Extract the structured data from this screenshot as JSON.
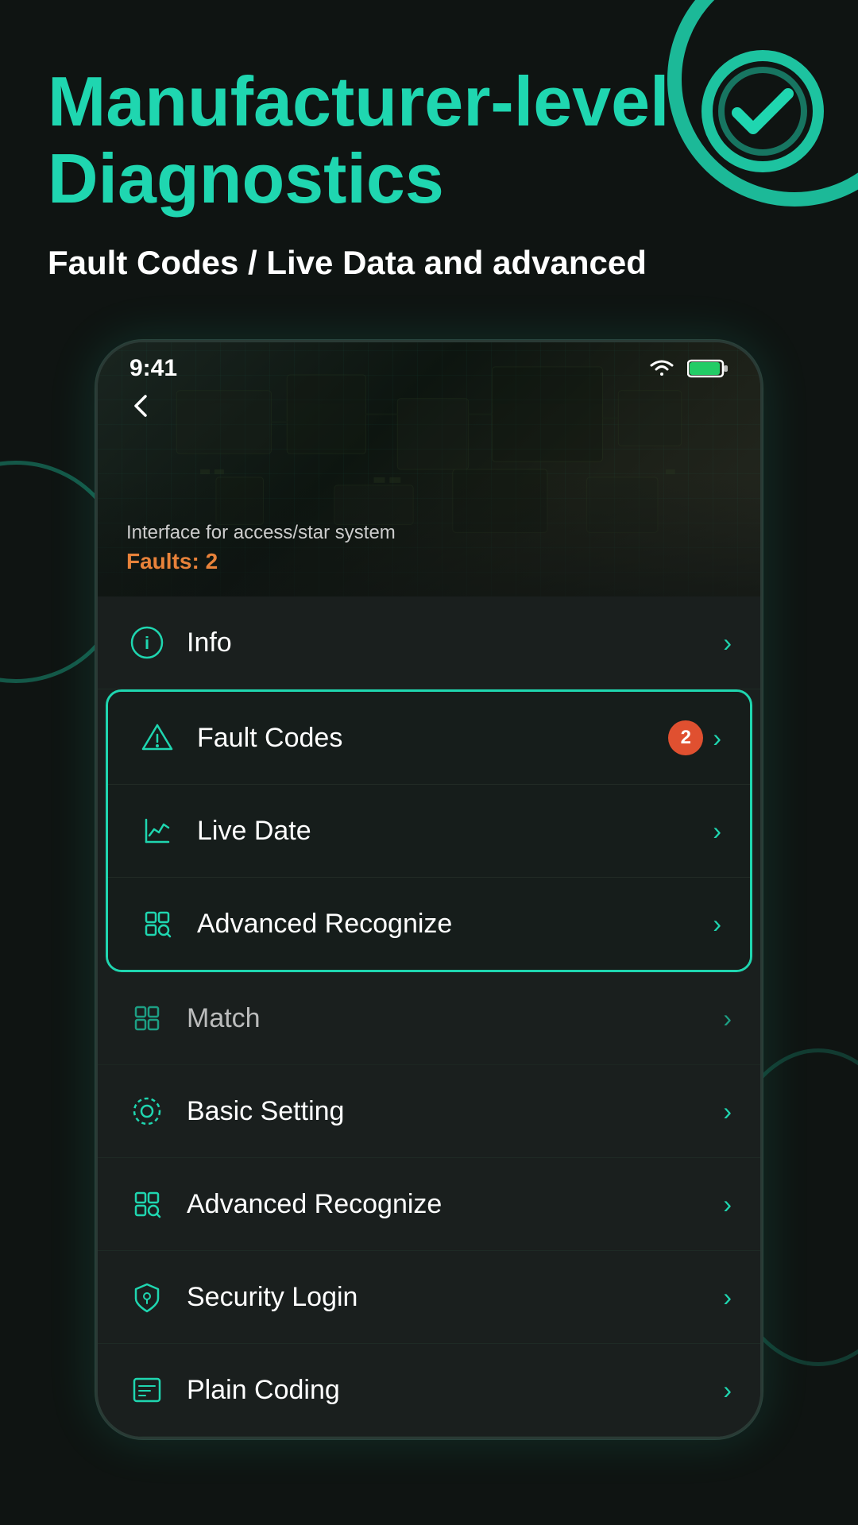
{
  "header": {
    "title_line1": "Manufacturer-level",
    "title_line2": "Diagnostics",
    "subtitle": "Fault Codes / Live Data and advanced"
  },
  "phone": {
    "status_bar": {
      "time": "9:41"
    },
    "hero": {
      "back_label": "‹",
      "interface_text": "Interface for access/star system",
      "faults_label": "Faults:",
      "faults_count": "2"
    },
    "menu_items": [
      {
        "id": "info",
        "icon": "info-icon",
        "label": "Info",
        "badge": null,
        "highlighted": false,
        "partial": false
      },
      {
        "id": "fault-codes",
        "icon": "alert-icon",
        "label": "Fault Codes",
        "badge": "2",
        "highlighted": true,
        "partial": false
      },
      {
        "id": "live-date",
        "icon": "chart-icon",
        "label": "Live Date",
        "badge": null,
        "highlighted": true,
        "partial": false
      },
      {
        "id": "advanced-recognize",
        "icon": "scan-icon",
        "label": "Advanced Recognize",
        "badge": null,
        "highlighted": true,
        "partial": false
      },
      {
        "id": "match",
        "icon": "match-icon",
        "label": "Match",
        "badge": null,
        "highlighted": false,
        "partial": true
      },
      {
        "id": "basic-setting",
        "icon": "settings-icon",
        "label": "Basic Setting",
        "badge": null,
        "highlighted": false,
        "partial": false
      },
      {
        "id": "advanced-recognize-2",
        "icon": "scan-icon",
        "label": "Advanced Recognize",
        "badge": null,
        "highlighted": false,
        "partial": false
      },
      {
        "id": "security-login",
        "icon": "security-icon",
        "label": "Security Login",
        "badge": null,
        "highlighted": false,
        "partial": false
      },
      {
        "id": "plain-coding",
        "icon": "coding-icon",
        "label": "Plain Coding",
        "badge": null,
        "highlighted": false,
        "partial": false
      }
    ]
  },
  "colors": {
    "teal": "#1fd6b0",
    "orange": "#e8823a",
    "red_badge": "#e05030",
    "bg_dark": "#0f1412",
    "bg_card": "#1a1f1e"
  }
}
